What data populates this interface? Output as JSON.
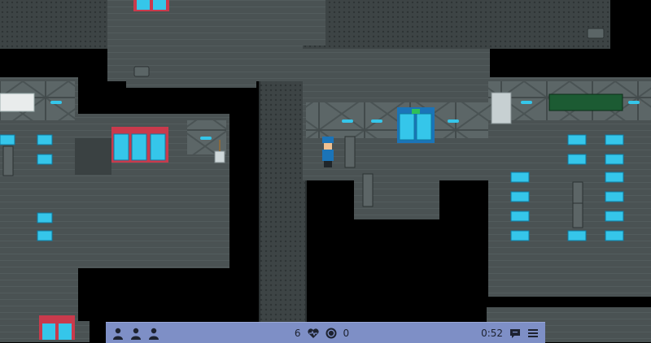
{
  "hud": {
    "player_icons": [
      "person-icon",
      "person-icon",
      "person-icon"
    ],
    "health_value": "6",
    "health_icon": "heart-pulse-icon",
    "coin_icon": "coin-icon",
    "coin_value": "0",
    "timer": "0:52",
    "chat_icon": "chat-icon",
    "menu_icon": "hamburger-menu-icon"
  },
  "colors": {
    "hud_bg": "#7e8fc6",
    "floor": "#4b5354",
    "wall": "#5f6a6b",
    "screen_glow": "#35c6ea",
    "vending_red": "#c93a4c",
    "board_green": "#1c5b33"
  }
}
